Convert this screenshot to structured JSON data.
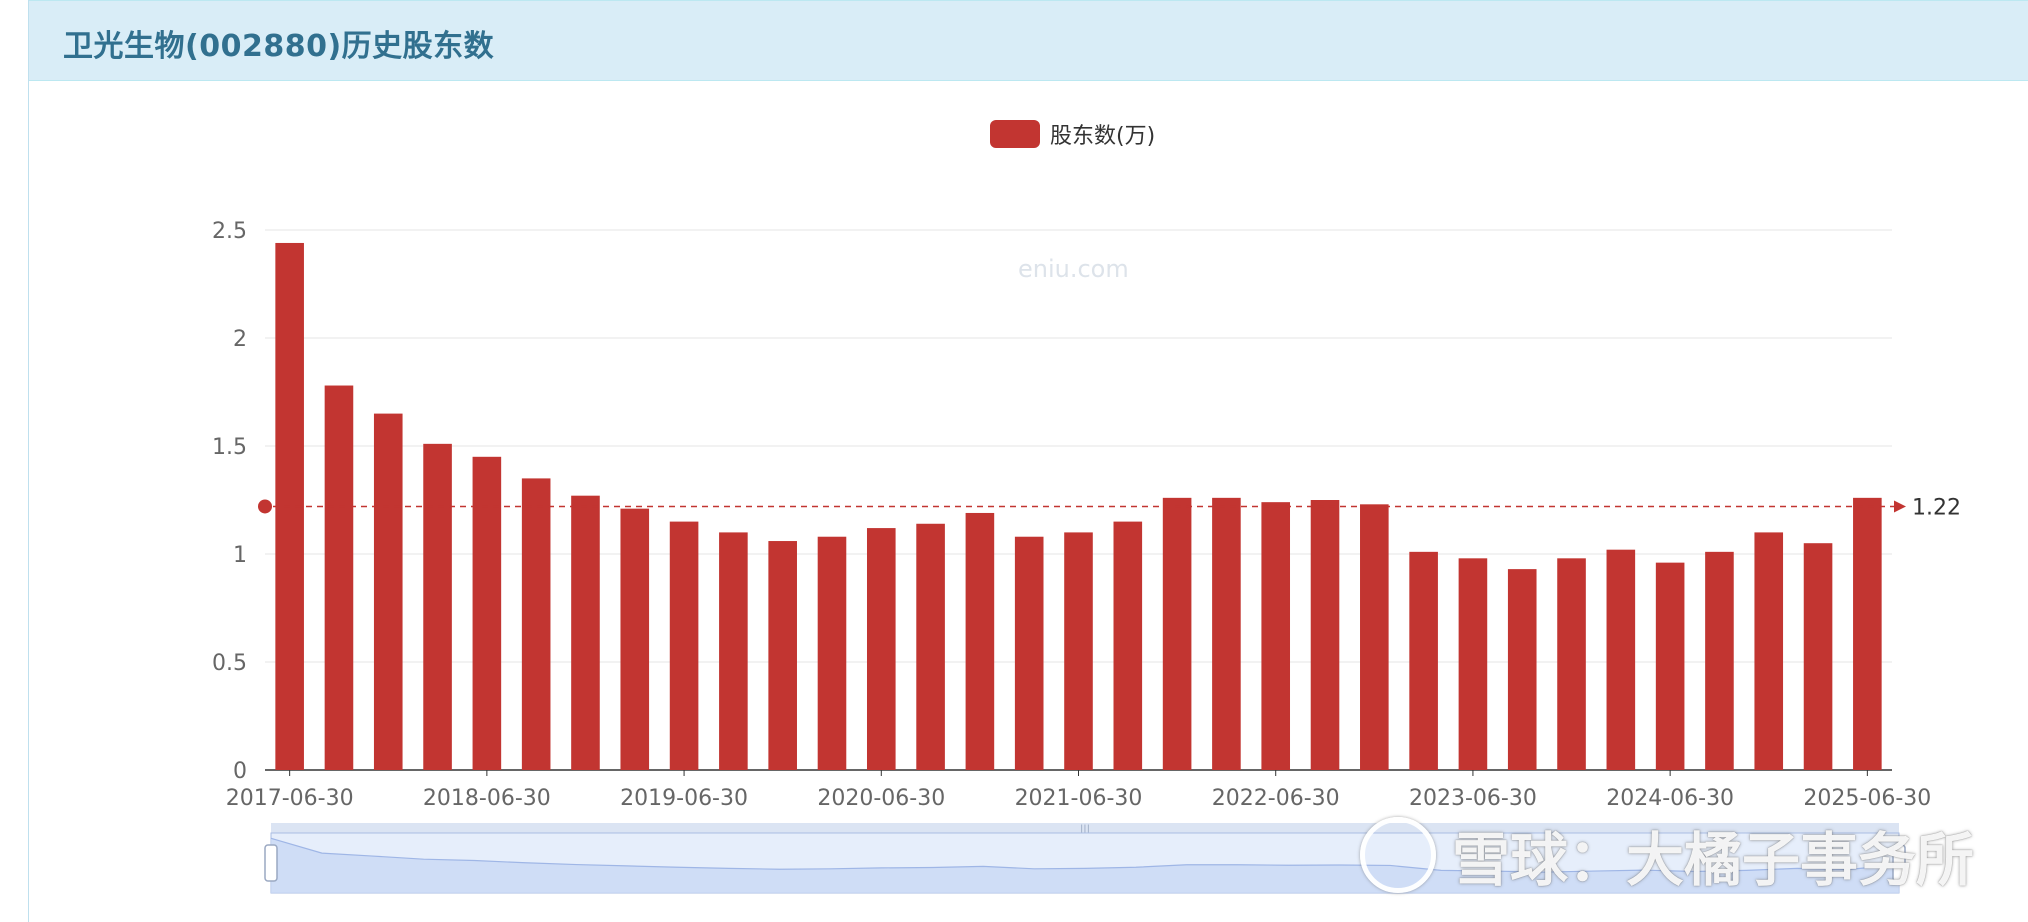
{
  "header": {
    "title": "卫光生物(002880)历史股东数"
  },
  "legend": {
    "label": "股东数(万)",
    "color": "#c23531"
  },
  "watermark": "eniu.com",
  "overlay_mark": {
    "text": "雪球：大橘子事务所"
  },
  "chart_data": {
    "type": "bar",
    "series": [
      {
        "name": "股东数(万)",
        "color": "#c23531",
        "values": [
          2.44,
          1.78,
          1.65,
          1.51,
          1.45,
          1.35,
          1.27,
          1.21,
          1.15,
          1.1,
          1.06,
          1.08,
          1.12,
          1.14,
          1.19,
          1.08,
          1.1,
          1.15,
          1.26,
          1.26,
          1.24,
          1.25,
          1.23,
          1.01,
          0.98,
          0.93,
          0.98,
          1.02,
          0.96,
          1.01,
          1.1,
          1.05,
          1.26
        ]
      }
    ],
    "x_tick_labels": [
      "2017-06-30",
      "2018-06-30",
      "2019-06-30",
      "2020-06-30",
      "2021-06-30",
      "2022-06-30",
      "2023-06-30",
      "2024-06-30",
      "2025-06-30"
    ],
    "x_tick_every": 4,
    "y_ticks": [
      "0",
      "0.5",
      "1",
      "1.5",
      "2",
      "2.5"
    ],
    "ylim": [
      0,
      2.5
    ],
    "markline": {
      "value": 1.22,
      "label": "1.22",
      "style": "dashed",
      "color": "#c23531"
    },
    "grid": true,
    "legend_position": "top-center",
    "datazoom": {
      "present": true,
      "range": [
        0,
        100
      ]
    }
  }
}
